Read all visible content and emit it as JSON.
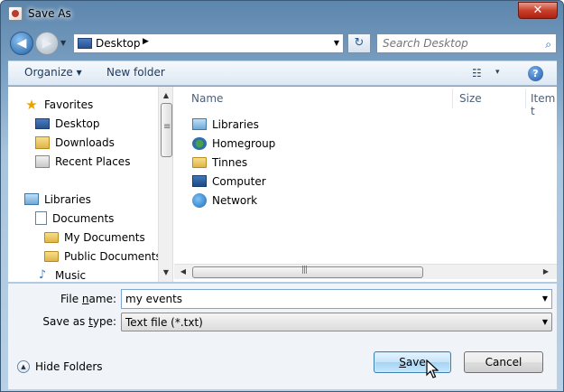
{
  "window": {
    "title": "Save As",
    "close_label": "✕"
  },
  "navbar": {
    "back_label": "◀",
    "forward_label": "▶",
    "history_label": "▼",
    "address_label": "Desktop",
    "address_chevron": "▶",
    "address_drop": "▼",
    "refresh_label": "↻",
    "search_placeholder": "Search Desktop",
    "search_icon": "⌕"
  },
  "toolbar": {
    "organize_label": "Organize ▾",
    "new_folder_label": "New folder",
    "view_icon": "☷",
    "view_drop": "▾",
    "help_label": "?"
  },
  "nav_pane": {
    "favorites": "Favorites",
    "desktop": "Desktop",
    "downloads": "Downloads",
    "recent_places": "Recent Places",
    "libraries": "Libraries",
    "documents": "Documents",
    "my_documents": "My Documents",
    "public_documents": "Public Documents",
    "music": "Music",
    "scroll_up": "▲",
    "scroll_down": "▼"
  },
  "file_list": {
    "columns": {
      "name": "Name",
      "size": "Size",
      "item_type": "Item t"
    },
    "items": [
      {
        "name": "Libraries",
        "icon": "libraries-icon"
      },
      {
        "name": "Homegroup",
        "icon": "homegroup-icon"
      },
      {
        "name": "Tinnes",
        "icon": "folder-icon"
      },
      {
        "name": "Computer",
        "icon": "computer-icon"
      },
      {
        "name": "Network",
        "icon": "network-icon"
      }
    ],
    "scroll_left": "◀",
    "scroll_right": "▶"
  },
  "form": {
    "file_name_label_pre": "File ",
    "file_name_label_u": "n",
    "file_name_label_post": "ame:",
    "file_name_value": "my events",
    "file_name_drop": "▼",
    "save_type_label_pre": "Save as ",
    "save_type_label_u": "t",
    "save_type_label_post": "ype:",
    "save_type_value": "Text file (*.txt)",
    "save_type_drop": "▼"
  },
  "footer": {
    "hide_folders_icon": "▲",
    "hide_folders_label": "Hide Folders",
    "save_label_u": "S",
    "save_label_rest": "ave",
    "cancel_label": "Cancel"
  }
}
